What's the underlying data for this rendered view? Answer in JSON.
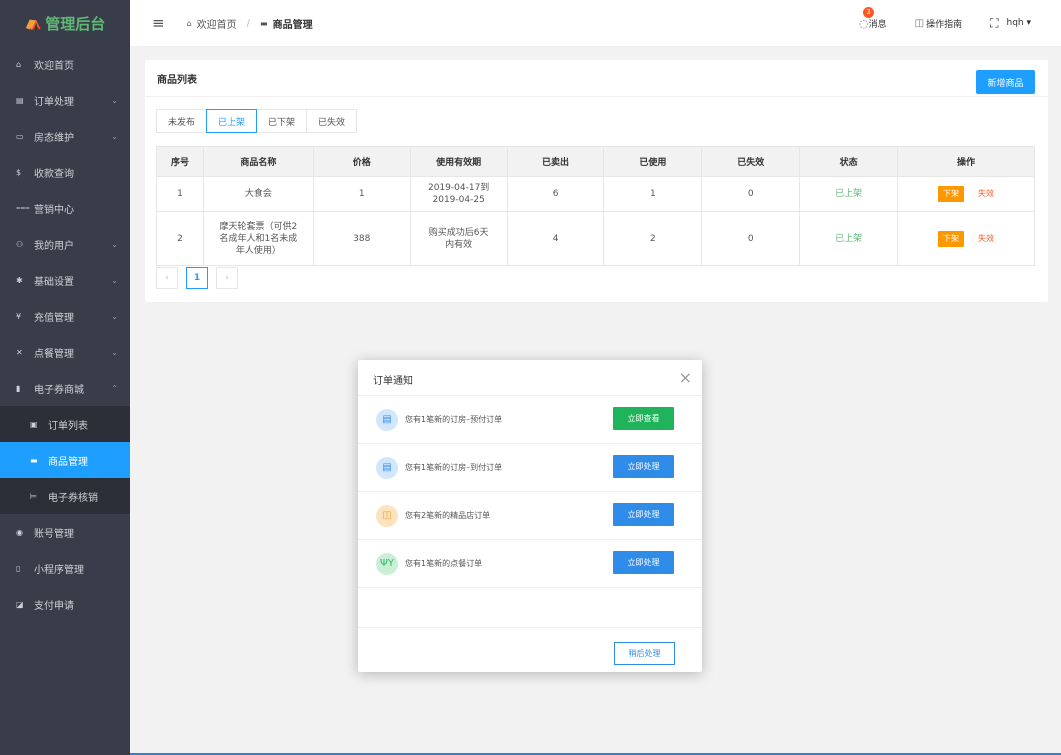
{
  "logo": {
    "mark": "⛺",
    "text": "管理后台"
  },
  "sidebar": {
    "items": [
      {
        "icon": "home-icon",
        "glyph": "⌂",
        "label": "欢迎首页",
        "chevron": ""
      },
      {
        "icon": "order-icon",
        "glyph": "▤",
        "label": "订单处理",
        "chevron": "⌄"
      },
      {
        "icon": "room-icon",
        "glyph": "▭",
        "label": "房态维护",
        "chevron": "⌄"
      },
      {
        "icon": "dollar-icon",
        "glyph": "$",
        "label": "收款查询",
        "chevron": ""
      },
      {
        "icon": "filter-icon",
        "glyph": "⩶",
        "label": "营销中心",
        "chevron": ""
      },
      {
        "icon": "users-icon",
        "glyph": "⚇",
        "label": "我的用户",
        "chevron": "⌄"
      },
      {
        "icon": "gear-icon",
        "glyph": "✱",
        "label": "基础设置",
        "chevron": "⌄"
      },
      {
        "icon": "yen-icon",
        "glyph": "¥",
        "label": "充值管理",
        "chevron": "⌄"
      },
      {
        "icon": "utensils-icon",
        "glyph": "✕",
        "label": "点餐管理",
        "chevron": "⌄"
      },
      {
        "icon": "bookmark-icon",
        "glyph": "▮",
        "label": "电子券商城",
        "chevron": "⌃"
      }
    ],
    "sub": [
      {
        "icon": "list-icon",
        "glyph": "▣",
        "label": "订单列表"
      },
      {
        "icon": "box-icon",
        "glyph": "▬",
        "label": "商品管理"
      },
      {
        "icon": "ticket-icon",
        "glyph": "⊨",
        "label": "电子券核销"
      }
    ],
    "tail": [
      {
        "icon": "account-icon",
        "glyph": "◉",
        "label": "账号管理"
      },
      {
        "icon": "phone-icon",
        "glyph": "▯",
        "label": "小程序管理"
      },
      {
        "icon": "pay-icon",
        "glyph": "◪",
        "label": "支付申请"
      }
    ]
  },
  "topbar": {
    "hamburger": "≡",
    "breadcrumb_home": "欢迎首页",
    "breadcrumb_sep": "/",
    "breadcrumb_current": "商品管理",
    "message_badge": "3",
    "message_label": "消息",
    "guide_label": "操作指南",
    "user": "hqh ▾"
  },
  "card": {
    "title": "商品列表",
    "new_button": "新增商品",
    "tabs": [
      "未发布",
      "已上架",
      "已下架",
      "已失效"
    ],
    "active_tab": 1,
    "columns": [
      "序号",
      "商品名称",
      "价格",
      "使用有效期",
      "已卖出",
      "已使用",
      "已失效",
      "状态",
      "操作"
    ],
    "rows": [
      {
        "no": "1",
        "name": "大食会",
        "price": "1",
        "validity": "2019-04-17到2019-04-25",
        "sold": "6",
        "used": "1",
        "expired": "0",
        "status": "已上架",
        "action_off": "下架",
        "action_invalid": "失效"
      },
      {
        "no": "2",
        "name": "摩天轮套票（可供2名成年人和1名未成年人使用）",
        "price": "388",
        "validity": "购买成功后6天内有效",
        "sold": "4",
        "used": "2",
        "expired": "0",
        "status": "已上架",
        "action_off": "下架",
        "action_invalid": "失效"
      }
    ],
    "pager": {
      "prev": "‹",
      "current": "1",
      "next": "›"
    }
  },
  "modal": {
    "title": "订单通知",
    "close": "×",
    "items": [
      {
        "icon": "bed-icon",
        "glyph": "▤",
        "tone": "blue",
        "text": "您有1笔新的订房–预付订单",
        "button": "立即查看",
        "button_tone": "green"
      },
      {
        "icon": "bed-icon",
        "glyph": "▤",
        "tone": "blue",
        "text": "您有1笔新的订房–到付订单",
        "button": "立即处理",
        "button_tone": "blue"
      },
      {
        "icon": "bag-icon",
        "glyph": "◫",
        "tone": "orange",
        "text": "您有2笔新的精品店订单",
        "button": "立即处理",
        "button_tone": "blue"
      },
      {
        "icon": "fork-icon",
        "glyph": "ΨΥ",
        "tone": "green",
        "text": "您有1笔新的点餐订单",
        "button": "立即处理",
        "button_tone": "blue"
      }
    ],
    "later_button": "稍后处理"
  }
}
